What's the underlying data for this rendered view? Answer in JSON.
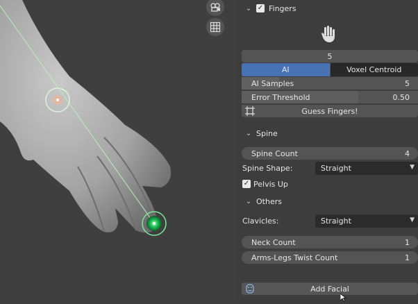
{
  "viewport": {
    "icons": [
      "camera-icon",
      "grid-icon"
    ]
  },
  "fingers": {
    "header": "Fingers",
    "enabled": true,
    "count_value": "5",
    "mode_options": [
      "AI",
      "Voxel Centroid"
    ],
    "mode_selected": "AI",
    "ai_samples_label": "AI Samples",
    "ai_samples_value": "5",
    "error_threshold_label": "Error Threshold",
    "error_threshold_value": "0.50",
    "guess_button": "Guess Fingers!"
  },
  "spine": {
    "header": "Spine",
    "spine_count_label": "Spine Count",
    "spine_count_value": "4",
    "spine_shape_label": "Spine Shape:",
    "spine_shape_value": "Straight",
    "pelvis_up_label": "Pelvis Up",
    "pelvis_up_checked": true
  },
  "others": {
    "header": "Others",
    "clavicles_label": "Clavicles:",
    "clavicles_value": "Straight",
    "neck_count_label": "Neck Count",
    "neck_count_value": "1",
    "twist_count_label": "Arms-Legs Twist Count",
    "twist_count_value": "1",
    "add_facial_button": "Add Facial"
  },
  "colors": {
    "accent": "#4772b3",
    "viewport_bg": "#3f3f3f",
    "panel_bg": "#3d3d3d",
    "marker_green": "#22c55e"
  }
}
